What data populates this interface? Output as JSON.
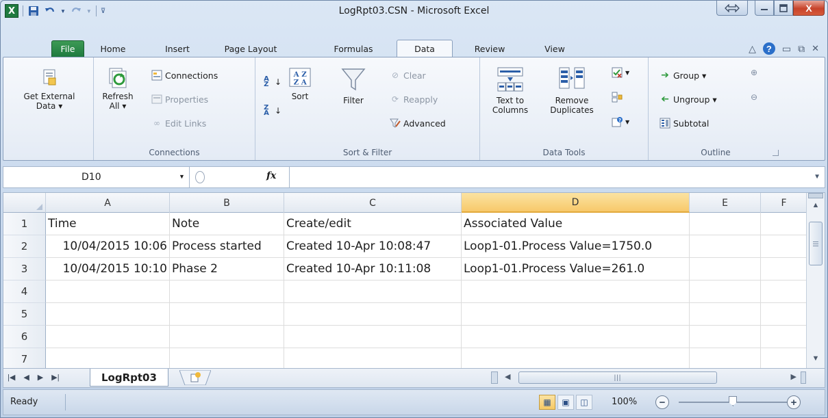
{
  "window": {
    "title": "LogRpt03.CSN  -  Microsoft Excel",
    "close_glyph": "X"
  },
  "ribbon_tabs": [
    "File",
    "Home",
    "Insert",
    "Page Layout",
    "Formulas",
    "Data",
    "Review",
    "View"
  ],
  "ribbon": {
    "get_external": [
      "Get External",
      "Data ▾"
    ],
    "connections_group": {
      "label": "Connections",
      "refresh": [
        "Refresh",
        "All ▾"
      ],
      "connections": "Connections",
      "properties": "Properties",
      "edit_links": "Edit Links"
    },
    "sort_filter_group": {
      "label": "Sort & Filter",
      "sort": "Sort",
      "filter": "Filter",
      "clear": "Clear",
      "reapply": "Reapply",
      "advanced": "Advanced"
    },
    "data_tools_group": {
      "label": "Data Tools",
      "text_to_columns": [
        "Text to",
        "Columns"
      ],
      "remove_duplicates": [
        "Remove",
        "Duplicates"
      ]
    },
    "outline_group": {
      "label": "Outline",
      "group": "Group ▾",
      "ungroup": "Ungroup ▾",
      "subtotal": "Subtotal"
    }
  },
  "formula_bar": {
    "name_box": "D10",
    "fx": "fx",
    "content": ""
  },
  "grid": {
    "columns": [
      "A",
      "B",
      "C",
      "D",
      "E",
      "F"
    ],
    "selected_column": "D",
    "row_numbers": [
      "1",
      "2",
      "3",
      "4",
      "5",
      "6",
      "7"
    ],
    "rows": [
      [
        "Time",
        "Note",
        "Create/edit",
        "Associated Value",
        "",
        ""
      ],
      [
        "10/04/2015 10:06",
        "Process started",
        "Created  10-Apr 10:08:47",
        "Loop1-01.Process Value=1750.0",
        "",
        ""
      ],
      [
        "10/04/2015 10:10",
        "Phase 2",
        "Created  10-Apr 10:11:08",
        "Loop1-01.Process Value=261.0",
        "",
        ""
      ],
      [
        "",
        "",
        "",
        "",
        "",
        ""
      ],
      [
        "",
        "",
        "",
        "",
        "",
        ""
      ],
      [
        "",
        "",
        "",
        "",
        "",
        ""
      ],
      [
        "",
        "",
        "",
        "",
        "",
        ""
      ]
    ]
  },
  "sheet_tabs": {
    "active": "LogRpt03",
    "scroll_grip": "|||"
  },
  "status": {
    "text": "Ready",
    "zoom": "100%",
    "zoom_minus": "−",
    "zoom_plus": "+"
  }
}
